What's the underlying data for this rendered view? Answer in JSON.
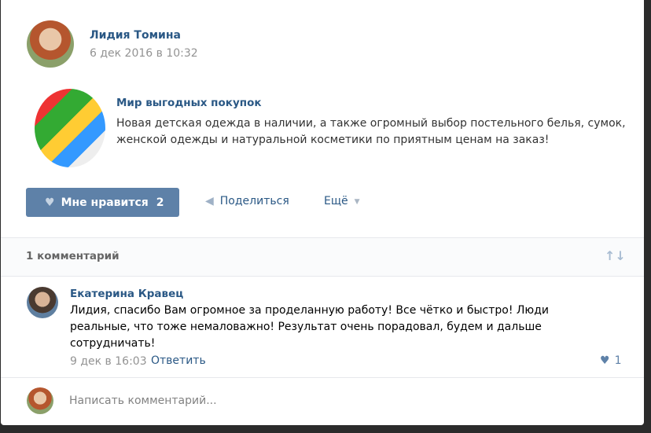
{
  "post": {
    "author": "Лидия Томина",
    "date": "6 дек 2016 в 10:32",
    "repost": {
      "title": "Мир выгодных покупок",
      "text": "Новая детская одежда в наличии, а также огромный выбор постельного белья, сумок, женской одежды и натуральной косметики по приятным ценам на заказ!"
    },
    "like_label": "Мне нравится",
    "like_count": "2",
    "share_label": "Поделиться",
    "more_label": "Ещё"
  },
  "comments": {
    "count_label": "1 комментарий",
    "items": [
      {
        "author": "Екатерина Кравец",
        "text": "Лидия, спасибо Вам огромное за проделанную работу! Все чётко и быстро! Люди реальные, что тоже немаловажно! Результат очень порадовал, будем и дальше сотрудничать!",
        "date": "9 дек в 16:03",
        "reply_label": "Ответить",
        "likes": "1"
      }
    ],
    "input_placeholder": "Написать комментарий..."
  },
  "colors": {
    "accent": "#5e81a8",
    "link": "#2a5885"
  }
}
